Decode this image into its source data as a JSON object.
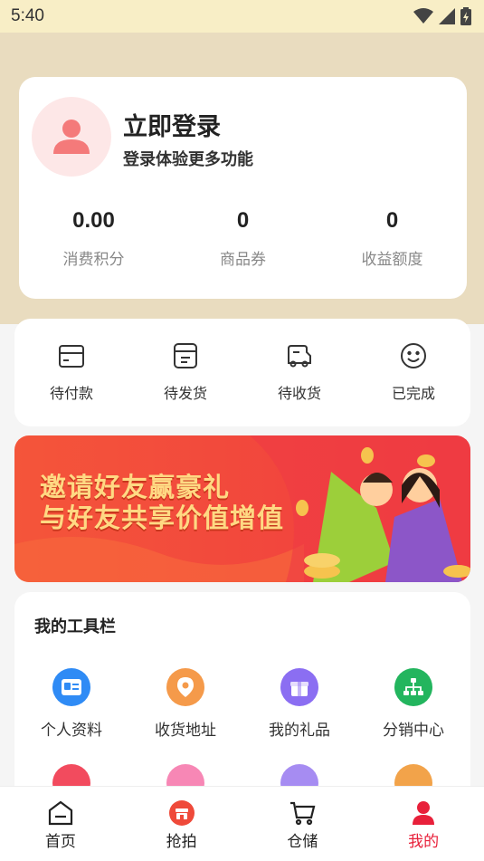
{
  "status_bar": {
    "time": "5:40"
  },
  "profile": {
    "title": "立即登录",
    "subtitle": "登录体验更多功能",
    "stats": [
      {
        "value": "0.00",
        "label": "消费积分"
      },
      {
        "value": "0",
        "label": "商品券"
      },
      {
        "value": "0",
        "label": "收益额度"
      }
    ]
  },
  "orders": [
    {
      "label": "待付款",
      "icon": "wallet-icon"
    },
    {
      "label": "待发货",
      "icon": "package-icon"
    },
    {
      "label": "待收货",
      "icon": "truck-icon"
    },
    {
      "label": "已完成",
      "icon": "smile-icon"
    }
  ],
  "banner": {
    "line1": "邀请好友赢豪礼",
    "line2": "与好友共享价值增值"
  },
  "tools": {
    "title": "我的工具栏",
    "items": [
      {
        "label": "个人资料",
        "icon": "id-card-icon",
        "color": "#2f8bf5"
      },
      {
        "label": "收货地址",
        "icon": "location-icon",
        "color": "#f59a4a"
      },
      {
        "label": "我的礼品",
        "icon": "gift-icon",
        "color": "#8b6ef2"
      },
      {
        "label": "分销中心",
        "icon": "network-icon",
        "color": "#23b55e"
      }
    ],
    "row2_icons": [
      {
        "icon": "flame-icon",
        "color": "#f24b5e"
      },
      {
        "icon": "shop-icon",
        "color": "#f787b5"
      },
      {
        "icon": "clipboard-icon",
        "color": "#a68cf2"
      },
      {
        "icon": "sync-icon",
        "color": "#f2a34a"
      }
    ]
  },
  "tabbar": {
    "tabs": [
      {
        "label": "首页",
        "icon": "home-icon"
      },
      {
        "label": "抢拍",
        "icon": "store-icon"
      },
      {
        "label": "仓储",
        "icon": "cart-icon"
      },
      {
        "label": "我的",
        "icon": "user-icon"
      }
    ],
    "active_color": "#e8203a"
  }
}
